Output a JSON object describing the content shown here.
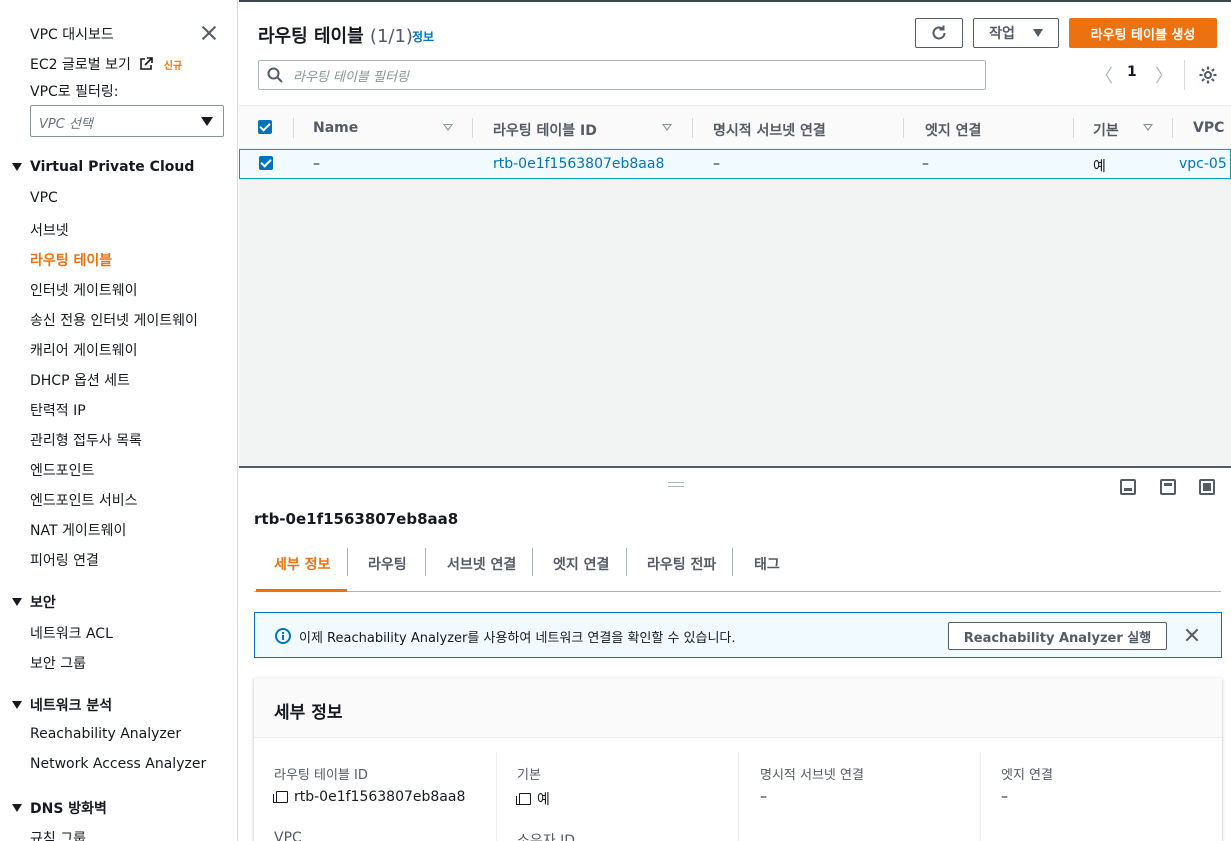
{
  "sidebar": {
    "dashboard": "VPC 대시보드",
    "ec2_global": "EC2 글로벌 보기",
    "new_badge": "신규",
    "filter_label": "VPC로 필터링:",
    "filter_placeholder": "VPC 선택",
    "section_vpc": "Virtual Private Cloud",
    "vpc_items": [
      "VPC",
      "서브넷",
      "라우팅 테이블",
      "인터넷 게이트웨이",
      "송신 전용 인터넷 게이트웨이",
      "캐리어 게이트웨이",
      "DHCP 옵션 세트",
      "탄력적 IP",
      "관리형 접두사 목록",
      "엔드포인트",
      "엔드포인트 서비스",
      "NAT 게이트웨이",
      "피어링 연결"
    ],
    "section_security": "보안",
    "security_items": [
      "네트워크 ACL",
      "보안 그룹"
    ],
    "section_analysis": "네트워크 분석",
    "analysis_items": [
      "Reachability Analyzer",
      "Network Access Analyzer"
    ],
    "section_dns": "DNS 방화벽",
    "dns_items": [
      "규칙 그룹"
    ]
  },
  "header": {
    "title": "라우팅 테이블",
    "count": "(1/1)",
    "info": "정보",
    "action_label": "작업",
    "create_label": "라우팅 테이블 생성",
    "search_placeholder": "라우팅 테이블 필터링",
    "page_number": "1"
  },
  "table": {
    "columns": [
      "Name",
      "라우팅 테이블 ID",
      "명시적 서브넷 연결",
      "엣지 연결",
      "기본",
      "VPC"
    ],
    "rows": [
      {
        "name": "–",
        "id": "rtb-0e1f1563807eb8aa8",
        "subnet": "–",
        "edge": "–",
        "main": "예",
        "vpc": "vpc-05"
      }
    ]
  },
  "details": {
    "title": "rtb-0e1f1563807eb8aa8",
    "tabs": [
      "세부 정보",
      "라우팅",
      "서브넷 연결",
      "엣지 연결",
      "라우팅 전파",
      "태그"
    ],
    "banner_text": "이제 Reachability Analyzer를 사용하여 네트워크 연결을 확인할 수 있습니다.",
    "banner_button": "Reachability Analyzer 실행",
    "card_title": "세부 정보",
    "fields": [
      {
        "label": "라우팅 테이블 ID",
        "value": "rtb-0e1f1563807eb8aa8"
      },
      {
        "label": "기본",
        "value": "예"
      },
      {
        "label": "명시적 서브넷 연결",
        "value": "–"
      },
      {
        "label": "엣지 연결",
        "value": "–"
      },
      {
        "label": "VPC",
        "value": ""
      },
      {
        "label": "소유자 ID",
        "value": ""
      }
    ]
  },
  "colors": {
    "accent": "#ec7211",
    "link": "#0073bb",
    "selected_bg": "#f1faff"
  }
}
